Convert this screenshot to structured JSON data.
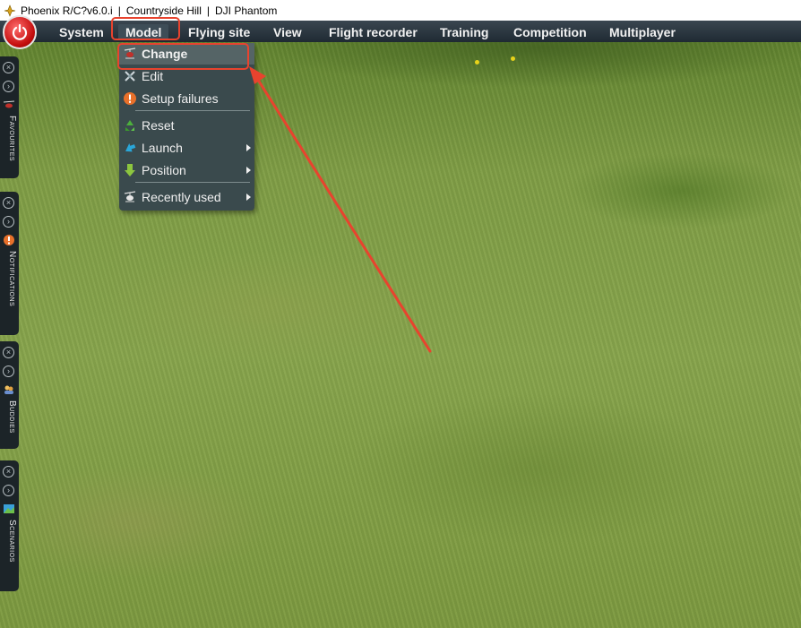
{
  "window": {
    "app_title": "Phoenix R/C?v6.0.i",
    "separator": "|",
    "flying_site": "Countryside Hill",
    "model": "DJI Phantom"
  },
  "menubar": {
    "items": [
      "System",
      "Model",
      "Flying site",
      "View",
      "Flight recorder",
      "Training",
      "Competition",
      "Multiplayer"
    ],
    "active": "Model"
  },
  "model_menu": {
    "items": [
      {
        "label": "Change",
        "icon": "helicopter-icon",
        "submenu": false
      },
      {
        "label": "Edit",
        "icon": "wrench-icon",
        "submenu": false
      },
      {
        "label": "Setup failures",
        "icon": "warning-icon",
        "submenu": false
      },
      {
        "label": "Reset",
        "icon": "recycle-icon",
        "submenu": true
      },
      {
        "label": "Launch",
        "icon": "launch-arrow-icon",
        "submenu": true
      },
      {
        "label": "Position",
        "icon": "down-arrow-icon",
        "submenu": true
      },
      {
        "label": "Recently used",
        "icon": "helicopter-icon",
        "submenu": true
      }
    ],
    "hovered": "Change"
  },
  "side_panels": [
    {
      "label": "Favourites",
      "icon": "helicopter-icon"
    },
    {
      "label": "Notifications",
      "icon": "warning-icon"
    },
    {
      "label": "Buddies",
      "icon": "buddies-icon"
    },
    {
      "label": "Scenarios",
      "icon": "scenario-icon"
    }
  ],
  "colors": {
    "menubar": "#1f2a33",
    "dropdown": "#3a4a4d",
    "annotation": "#e8432e",
    "power_button": "#c40d0d"
  }
}
